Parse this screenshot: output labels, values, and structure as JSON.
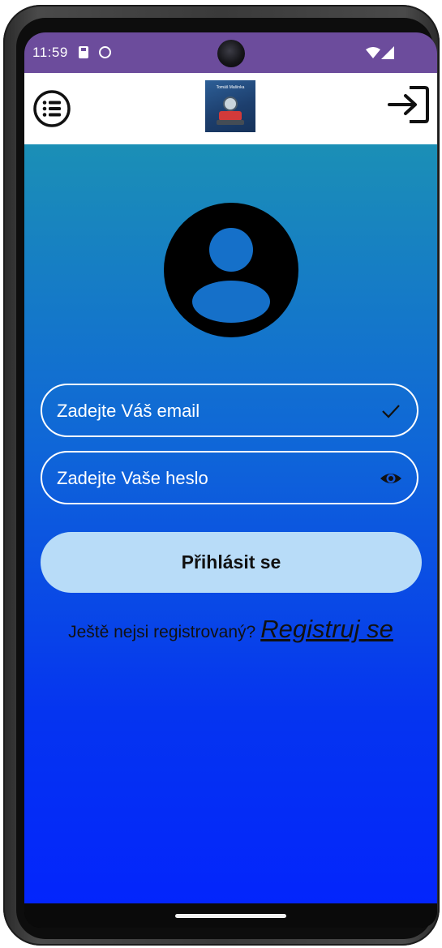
{
  "status_bar": {
    "time": "11:59",
    "icons": [
      "sd-card-icon",
      "sync-icon",
      "wifi-icon",
      "cell-signal-icon"
    ]
  },
  "app_bar": {
    "menu_icon": "menu-list-icon",
    "login_icon": "login-arrow-icon",
    "logo_caption": "Tomáš Mašinka"
  },
  "form": {
    "email_placeholder": "Zadejte Váš email",
    "password_placeholder": "Zadejte Vaše heslo",
    "email_icon": "check-icon",
    "password_icon": "eye-icon",
    "login_button": "Přihlásit se",
    "register_prompt": "Ještě nejsi registrovaný?",
    "register_link": "Registruj se"
  },
  "colors": {
    "status_bar": "#6c4c9c",
    "gradient_top": "#1b8fb6",
    "gradient_bottom": "#0325fc",
    "button_bg": "#b8dcf8"
  }
}
